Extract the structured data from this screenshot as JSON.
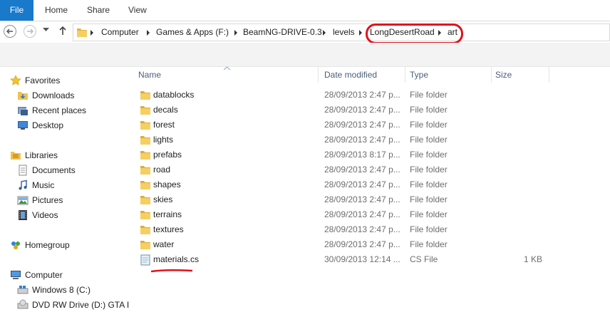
{
  "ribbon": {
    "tabs": [
      "File",
      "Home",
      "Share",
      "View"
    ]
  },
  "address": {
    "crumbs": [
      "Computer",
      "Games & Apps (F:)",
      "BeamNG-DRIVE-0.3",
      "levels",
      "LongDesertRoad",
      "art"
    ]
  },
  "navpane": {
    "favorites": "Favorites",
    "downloads": "Downloads",
    "recent_places": "Recent places",
    "desktop": "Desktop",
    "libraries": "Libraries",
    "documents": "Documents",
    "music": "Music",
    "pictures": "Pictures",
    "videos": "Videos",
    "homegroup": "Homegroup",
    "computer": "Computer",
    "drive_c": "Windows 8 (C:)",
    "drive_d": "DVD RW Drive (D:) GTA I"
  },
  "columns": {
    "name": "Name",
    "date": "Date modified",
    "type": "Type",
    "size": "Size"
  },
  "files": [
    {
      "name": "datablocks",
      "date": "28/09/2013 2:47 p...",
      "type": "File folder",
      "size": "",
      "kind": "folder"
    },
    {
      "name": "decals",
      "date": "28/09/2013 2:47 p...",
      "type": "File folder",
      "size": "",
      "kind": "folder"
    },
    {
      "name": "forest",
      "date": "28/09/2013 2:47 p...",
      "type": "File folder",
      "size": "",
      "kind": "folder"
    },
    {
      "name": "lights",
      "date": "28/09/2013 2:47 p...",
      "type": "File folder",
      "size": "",
      "kind": "folder"
    },
    {
      "name": "prefabs",
      "date": "28/09/2013 8:17 p...",
      "type": "File folder",
      "size": "",
      "kind": "folder"
    },
    {
      "name": "road",
      "date": "28/09/2013 2:47 p...",
      "type": "File folder",
      "size": "",
      "kind": "folder"
    },
    {
      "name": "shapes",
      "date": "28/09/2013 2:47 p...",
      "type": "File folder",
      "size": "",
      "kind": "folder"
    },
    {
      "name": "skies",
      "date": "28/09/2013 2:47 p...",
      "type": "File folder",
      "size": "",
      "kind": "folder"
    },
    {
      "name": "terrains",
      "date": "28/09/2013 2:47 p...",
      "type": "File folder",
      "size": "",
      "kind": "folder"
    },
    {
      "name": "textures",
      "date": "28/09/2013 2:47 p...",
      "type": "File folder",
      "size": "",
      "kind": "folder"
    },
    {
      "name": "water",
      "date": "28/09/2013 2:47 p...",
      "type": "File folder",
      "size": "",
      "kind": "folder"
    },
    {
      "name": "materials.cs",
      "date": "30/09/2013 12:14 ...",
      "type": "CS File",
      "size": "1 KB",
      "kind": "file"
    }
  ],
  "colors": {
    "file_tab": "#1979ca",
    "annotation": "#e0121c",
    "folder": "#f0c24f"
  }
}
